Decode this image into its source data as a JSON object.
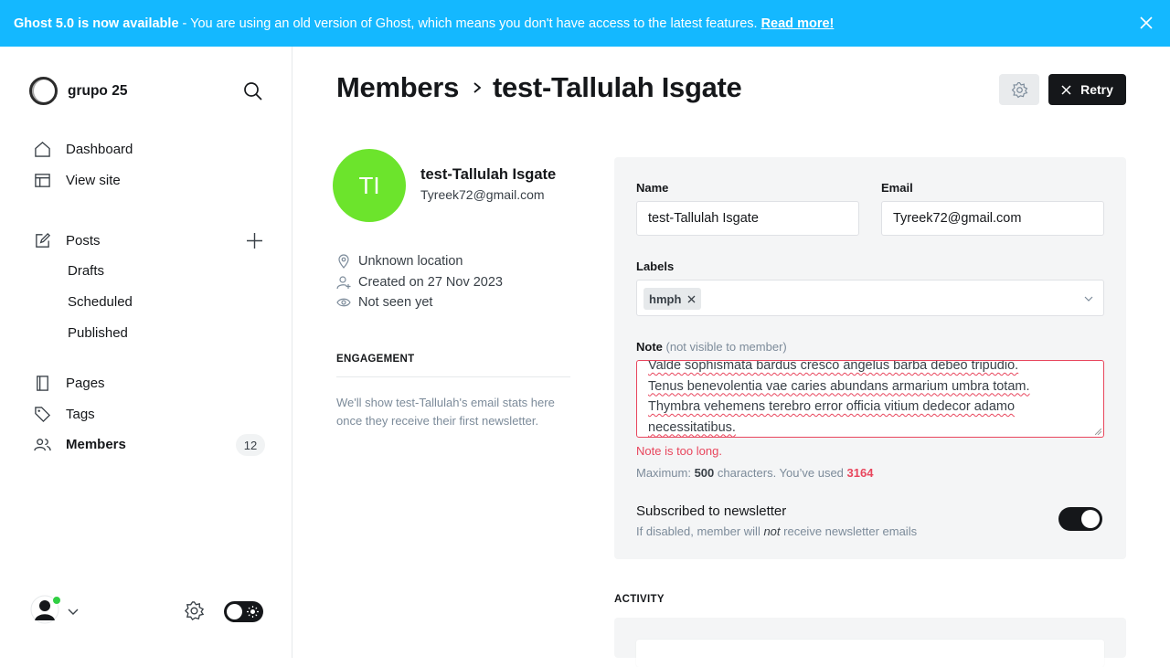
{
  "banner": {
    "headline": "Ghost 5.0 is now available",
    "message": " - You are using an old version of Ghost, which means you don't have access to the latest features.",
    "link": "Read more!"
  },
  "sidebar": {
    "site_name": "grupo 25",
    "nav": {
      "dashboard": "Dashboard",
      "view_site": "View site",
      "posts": "Posts",
      "drafts": "Drafts",
      "scheduled": "Scheduled",
      "published": "Published",
      "pages": "Pages",
      "tags": "Tags",
      "members": "Members",
      "members_count": "12"
    }
  },
  "header": {
    "section": "Members",
    "member": "test-Tallulah Isgate",
    "retry_label": "Retry"
  },
  "member": {
    "initials": "TI",
    "name": "test-Tallulah Isgate",
    "email": "Tyreek72@gmail.com",
    "location": "Unknown location",
    "created": "Created on 27 Nov 2023",
    "last_seen": "Not seen yet",
    "engagement_title": "ENGAGEMENT",
    "engagement_text": "We'll show test-Tallulah's email stats here once they receive their first newsletter.",
    "avatar_color": "#6ce42c"
  },
  "form": {
    "name_label": "Name",
    "name_value": "test-Tallulah Isgate",
    "email_label": "Email",
    "email_value": "Tyreek72@gmail.com",
    "labels_label": "Labels",
    "labels": [
      "hmph"
    ],
    "note_label": "Note",
    "note_hint": "(not visible to member)",
    "note_lines": [
      "Valde sophismata bardus cresco angelus barba debeo tripudio.",
      "Tenus benevolentia vae caries abundans armarium umbra totam.",
      "Thymbra vehemens terebro error officia vitium dedecor adamo",
      "necessitatibus."
    ],
    "note_error": "Note is too long.",
    "max_prefix": "Maximum: ",
    "max_value": "500",
    "max_mid": " characters. You’ve used ",
    "used_value": "3164",
    "subscribe_title": "Subscribed to newsletter",
    "subscribe_desc_pre": "If disabled, member will ",
    "subscribe_desc_em": "not",
    "subscribe_desc_post": " receive newsletter emails",
    "subscribed": true
  },
  "activity": {
    "title": "ACTIVITY"
  },
  "colors": {
    "banner": "#14b8ff",
    "error": "#e8465d",
    "primary_button": "#15171a"
  }
}
